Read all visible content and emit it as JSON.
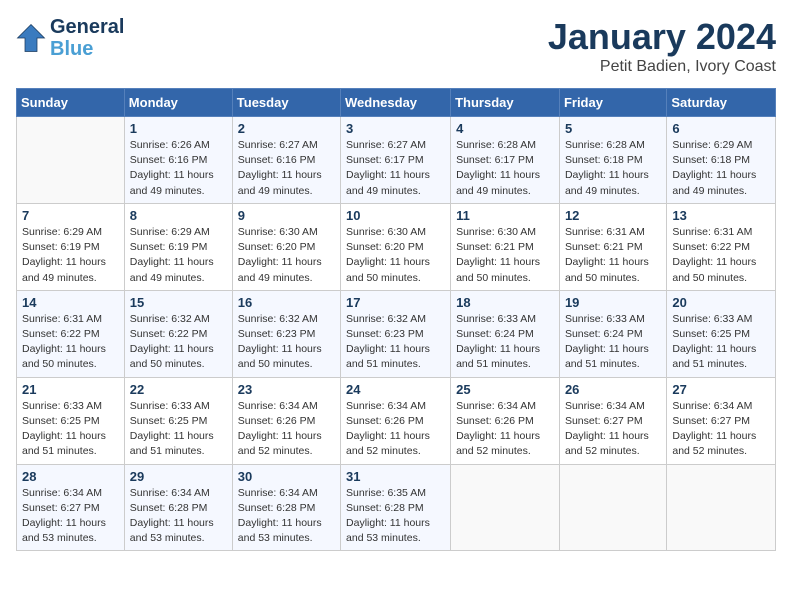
{
  "header": {
    "logo_line1": "General",
    "logo_line2": "Blue",
    "month_year": "January 2024",
    "location": "Petit Badien, Ivory Coast"
  },
  "weekdays": [
    "Sunday",
    "Monday",
    "Tuesday",
    "Wednesday",
    "Thursday",
    "Friday",
    "Saturday"
  ],
  "weeks": [
    [
      {
        "day": "",
        "info": ""
      },
      {
        "day": "1",
        "info": "Sunrise: 6:26 AM\nSunset: 6:16 PM\nDaylight: 11 hours\nand 49 minutes."
      },
      {
        "day": "2",
        "info": "Sunrise: 6:27 AM\nSunset: 6:16 PM\nDaylight: 11 hours\nand 49 minutes."
      },
      {
        "day": "3",
        "info": "Sunrise: 6:27 AM\nSunset: 6:17 PM\nDaylight: 11 hours\nand 49 minutes."
      },
      {
        "day": "4",
        "info": "Sunrise: 6:28 AM\nSunset: 6:17 PM\nDaylight: 11 hours\nand 49 minutes."
      },
      {
        "day": "5",
        "info": "Sunrise: 6:28 AM\nSunset: 6:18 PM\nDaylight: 11 hours\nand 49 minutes."
      },
      {
        "day": "6",
        "info": "Sunrise: 6:29 AM\nSunset: 6:18 PM\nDaylight: 11 hours\nand 49 minutes."
      }
    ],
    [
      {
        "day": "7",
        "info": "Sunrise: 6:29 AM\nSunset: 6:19 PM\nDaylight: 11 hours\nand 49 minutes."
      },
      {
        "day": "8",
        "info": "Sunrise: 6:29 AM\nSunset: 6:19 PM\nDaylight: 11 hours\nand 49 minutes."
      },
      {
        "day": "9",
        "info": "Sunrise: 6:30 AM\nSunset: 6:20 PM\nDaylight: 11 hours\nand 49 minutes."
      },
      {
        "day": "10",
        "info": "Sunrise: 6:30 AM\nSunset: 6:20 PM\nDaylight: 11 hours\nand 50 minutes."
      },
      {
        "day": "11",
        "info": "Sunrise: 6:30 AM\nSunset: 6:21 PM\nDaylight: 11 hours\nand 50 minutes."
      },
      {
        "day": "12",
        "info": "Sunrise: 6:31 AM\nSunset: 6:21 PM\nDaylight: 11 hours\nand 50 minutes."
      },
      {
        "day": "13",
        "info": "Sunrise: 6:31 AM\nSunset: 6:22 PM\nDaylight: 11 hours\nand 50 minutes."
      }
    ],
    [
      {
        "day": "14",
        "info": "Sunrise: 6:31 AM\nSunset: 6:22 PM\nDaylight: 11 hours\nand 50 minutes."
      },
      {
        "day": "15",
        "info": "Sunrise: 6:32 AM\nSunset: 6:22 PM\nDaylight: 11 hours\nand 50 minutes."
      },
      {
        "day": "16",
        "info": "Sunrise: 6:32 AM\nSunset: 6:23 PM\nDaylight: 11 hours\nand 50 minutes."
      },
      {
        "day": "17",
        "info": "Sunrise: 6:32 AM\nSunset: 6:23 PM\nDaylight: 11 hours\nand 51 minutes."
      },
      {
        "day": "18",
        "info": "Sunrise: 6:33 AM\nSunset: 6:24 PM\nDaylight: 11 hours\nand 51 minutes."
      },
      {
        "day": "19",
        "info": "Sunrise: 6:33 AM\nSunset: 6:24 PM\nDaylight: 11 hours\nand 51 minutes."
      },
      {
        "day": "20",
        "info": "Sunrise: 6:33 AM\nSunset: 6:25 PM\nDaylight: 11 hours\nand 51 minutes."
      }
    ],
    [
      {
        "day": "21",
        "info": "Sunrise: 6:33 AM\nSunset: 6:25 PM\nDaylight: 11 hours\nand 51 minutes."
      },
      {
        "day": "22",
        "info": "Sunrise: 6:33 AM\nSunset: 6:25 PM\nDaylight: 11 hours\nand 51 minutes."
      },
      {
        "day": "23",
        "info": "Sunrise: 6:34 AM\nSunset: 6:26 PM\nDaylight: 11 hours\nand 52 minutes."
      },
      {
        "day": "24",
        "info": "Sunrise: 6:34 AM\nSunset: 6:26 PM\nDaylight: 11 hours\nand 52 minutes."
      },
      {
        "day": "25",
        "info": "Sunrise: 6:34 AM\nSunset: 6:26 PM\nDaylight: 11 hours\nand 52 minutes."
      },
      {
        "day": "26",
        "info": "Sunrise: 6:34 AM\nSunset: 6:27 PM\nDaylight: 11 hours\nand 52 minutes."
      },
      {
        "day": "27",
        "info": "Sunrise: 6:34 AM\nSunset: 6:27 PM\nDaylight: 11 hours\nand 52 minutes."
      }
    ],
    [
      {
        "day": "28",
        "info": "Sunrise: 6:34 AM\nSunset: 6:27 PM\nDaylight: 11 hours\nand 53 minutes."
      },
      {
        "day": "29",
        "info": "Sunrise: 6:34 AM\nSunset: 6:28 PM\nDaylight: 11 hours\nand 53 minutes."
      },
      {
        "day": "30",
        "info": "Sunrise: 6:34 AM\nSunset: 6:28 PM\nDaylight: 11 hours\nand 53 minutes."
      },
      {
        "day": "31",
        "info": "Sunrise: 6:35 AM\nSunset: 6:28 PM\nDaylight: 11 hours\nand 53 minutes."
      },
      {
        "day": "",
        "info": ""
      },
      {
        "day": "",
        "info": ""
      },
      {
        "day": "",
        "info": ""
      }
    ]
  ]
}
